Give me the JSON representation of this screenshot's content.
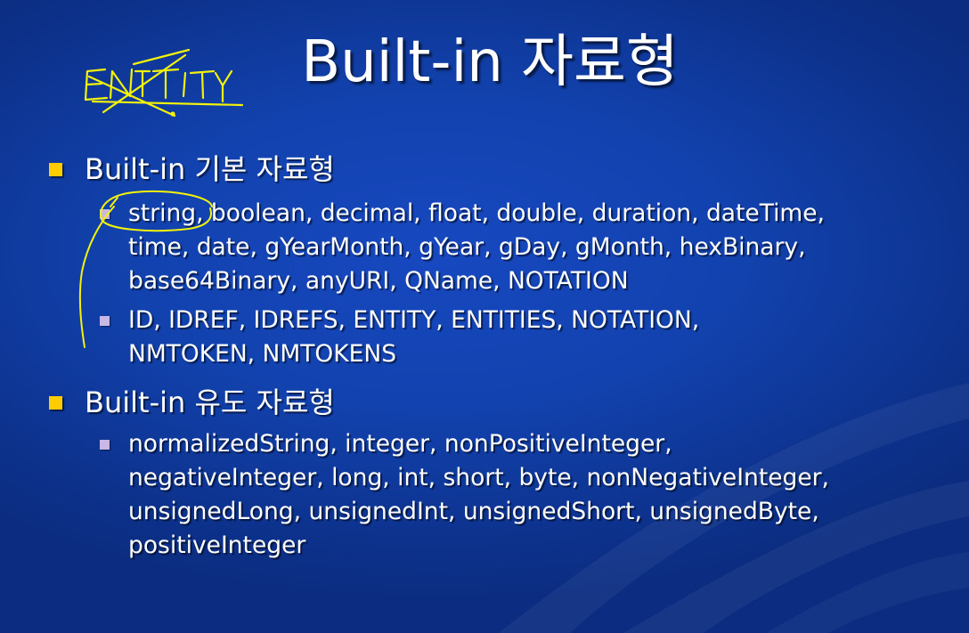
{
  "slide": {
    "title": "Built-in 자료형",
    "sections": [
      {
        "heading": "Built-in 기본 자료형",
        "items": [
          "string, boolean, decimal, float, double, duration, dateTime,\ntime, date, gYearMonth, gYear, gDay, gMonth, hexBinary,\nbase64Binary, anyURI, QName, NOTATION",
          "ID, IDREF, IDREFS, ENTITY, ENTITIES, NOTATION,\nNMTOKEN, NMTOKENS"
        ]
      },
      {
        "heading": "Built-in 유도 자료형",
        "items": [
          "normalizedString, integer, nonPositiveInteger,\nnegativeInteger, long, int, short, byte, nonNegativeInteger,\nunsignedLong, unsignedInt, unsignedShort, unsignedByte,\npositiveInteger"
        ]
      }
    ]
  },
  "colors": {
    "background": "#1242ae",
    "text": "#ffffff",
    "level1_bullet": "#ffcc00",
    "level2_bullet": "#c9b8e6",
    "annotation_ink": "#f2f20a"
  },
  "annotations": {
    "handwritten_note": "ENTITY"
  }
}
